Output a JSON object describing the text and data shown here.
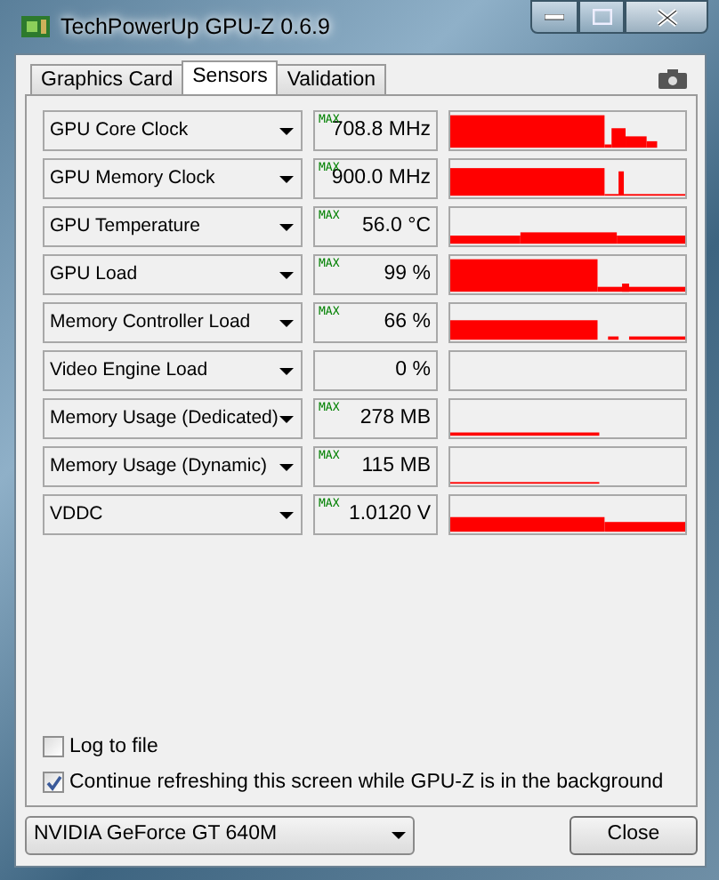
{
  "window": {
    "title": "TechPowerUp GPU-Z 0.6.9"
  },
  "tabs": [
    {
      "label": "Graphics Card",
      "selected": false
    },
    {
      "label": "Sensors",
      "selected": true
    },
    {
      "label": "Validation",
      "selected": false
    }
  ],
  "sensors": [
    {
      "name": "GPU Core Clock",
      "max": "MAX",
      "reading": "708.8 MHz"
    },
    {
      "name": "GPU Memory Clock",
      "max": "MAX",
      "reading": "900.0 MHz"
    },
    {
      "name": "GPU Temperature",
      "max": "MAX",
      "reading": "56.0 °C"
    },
    {
      "name": "GPU Load",
      "max": "MAX",
      "reading": "99 %"
    },
    {
      "name": "Memory Controller Load",
      "max": "MAX",
      "reading": "66 %"
    },
    {
      "name": "Video Engine Load",
      "reading": "0 %"
    },
    {
      "name": "Memory Usage (Dedicated)",
      "max": "MAX",
      "reading": "278 MB"
    },
    {
      "name": "Memory Usage (Dynamic)",
      "max": "MAX",
      "reading": "115 MB"
    },
    {
      "name": "VDDC",
      "max": "MAX",
      "reading": "1.0120 V"
    }
  ],
  "options": [
    {
      "label": "Log to file",
      "checked": false
    },
    {
      "label": "Continue refreshing this screen while GPU-Z is in the background",
      "checked": true
    }
  ],
  "device": {
    "value": "NVIDIA GeForce GT 640M"
  },
  "buttons": [
    "Close"
  ]
}
